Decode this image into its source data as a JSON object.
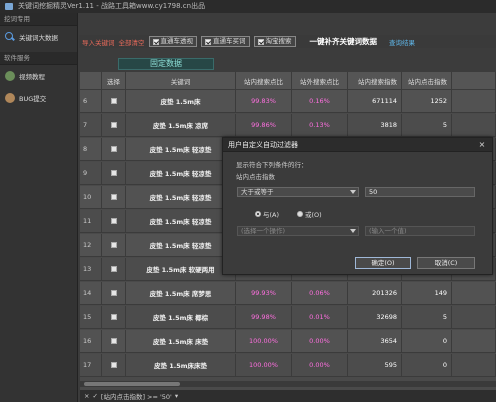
{
  "window": {
    "title": "关键词挖掘精灵Ver1.11 - 战路工具箱www.cy1798.cn出品"
  },
  "sidebar": {
    "section1": "挖词专用",
    "item1": "关键词大数据",
    "section2": "软件服务",
    "item2": "视频教程",
    "item3": "BUG提交"
  },
  "toolbar": {
    "import": "导入关键词",
    "clear": "全部清空",
    "opt1": "直通车透视",
    "opt2": "直通车买词",
    "opt3": "淘宝搜索",
    "complete": "一键补齐关键词数据",
    "query": "查询结果"
  },
  "banner": "固定数据",
  "table": {
    "headers": [
      "",
      "选择",
      "关键词",
      "站内搜索点比",
      "站外搜索点比",
      "站内搜索指数",
      "站内点击指数",
      ""
    ],
    "rows": [
      {
        "n": "6",
        "kw": "皮垫 1.5m床",
        "a": "99.83%",
        "b": "0.16%",
        "c": "671114",
        "d": "1252",
        "e": ""
      },
      {
        "n": "7",
        "kw": "皮垫 1.5m床 凉席",
        "a": "99.86%",
        "b": "0.13%",
        "c": "3818",
        "d": "5",
        "e": ""
      },
      {
        "n": "8",
        "kw": "皮垫 1.5m床 轻凉垫",
        "a": "",
        "b": "",
        "c": "",
        "d": "",
        "e": ""
      },
      {
        "n": "9",
        "kw": "皮垫 1.5m床 轻凉垫",
        "a": "",
        "b": "",
        "c": "",
        "d": "",
        "e": ""
      },
      {
        "n": "10",
        "kw": "皮垫 1.5m床 轻凉垫",
        "a": "",
        "b": "",
        "c": "",
        "d": "",
        "e": ""
      },
      {
        "n": "11",
        "kw": "皮垫 1.5m床 轻凉垫",
        "a": "",
        "b": "",
        "c": "",
        "d": "",
        "e": ""
      },
      {
        "n": "12",
        "kw": "皮垫 1.5m床 轻凉垫",
        "a": "",
        "b": "",
        "c": "",
        "d": "",
        "e": ""
      },
      {
        "n": "13",
        "kw": "皮垫 1.5m床 软硬两用",
        "a": "",
        "b": "",
        "c": "",
        "d": "",
        "e": ""
      },
      {
        "n": "14",
        "kw": "皮垫 1.5m床 席梦思",
        "a": "99.93%",
        "b": "0.06%",
        "c": "201326",
        "d": "149",
        "e": ""
      },
      {
        "n": "15",
        "kw": "皮垫 1.5m床 椰棕",
        "a": "99.98%",
        "b": "0.01%",
        "c": "32698",
        "d": "5",
        "e": ""
      },
      {
        "n": "16",
        "kw": "皮垫 1.5m床 床垫",
        "a": "100.00%",
        "b": "0.00%",
        "c": "3654",
        "d": "0",
        "e": ""
      },
      {
        "n": "17",
        "kw": "皮垫 1.5m床床垫",
        "a": "100.00%",
        "b": "0.00%",
        "c": "595",
        "d": "0",
        "e": ""
      }
    ]
  },
  "status": {
    "close": "×",
    "check": "✓",
    "filter": "[站内点击指数] >= '50'",
    "dropdown": "▾"
  },
  "dialog": {
    "title": "用户自定义自动过滤器",
    "close": "×",
    "prompt": "显示符合下列条件的行：",
    "field": "站内点击指数",
    "op1": "大于或等于",
    "val1": "50",
    "and": "与(A)",
    "or": "或(O)",
    "op2": "(选择一个操作)",
    "val2": "(输入一个值)",
    "ok": "确定(O)",
    "cancel": "取消(C)"
  }
}
